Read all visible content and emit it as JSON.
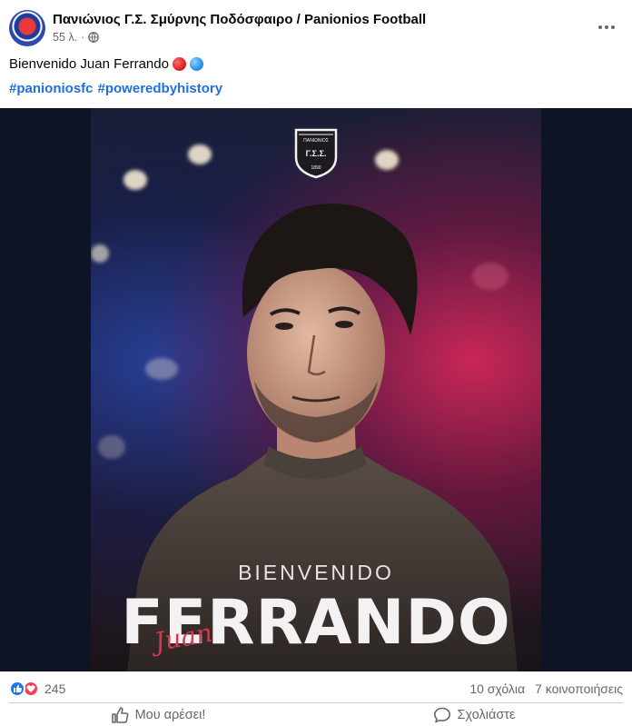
{
  "post": {
    "page_name": "Πανιώνιος Γ.Σ. Σμύρνης Ποδόσφαιρο / Panionios Football",
    "time": "55 λ.",
    "separator": "·",
    "caption": "Bienvenido Juan Ferrando",
    "hashtags": [
      "#panioniosfc",
      "#poweredbyhistory"
    ]
  },
  "poster": {
    "club_name": "ΠΑΝΙΩΝΙΟΣ",
    "club_initials": "Γ.Σ.Σ.",
    "club_year": "1890",
    "headline": "BIENVENIDO",
    "surname": "FERRANDO",
    "first_name_script": "Juan"
  },
  "engagement": {
    "reaction_count": "245",
    "comments": "10 σχόλια",
    "shares": "7 κοινοποιήσεις",
    "reactions": [
      "like-icon",
      "love-icon"
    ]
  },
  "actions": {
    "like_label": "Μου αρέσει!",
    "comment_label": "Σχολιάστε"
  },
  "colors": {
    "link": "#216fdb",
    "muted": "#65676b",
    "like_blue": "#1877f2",
    "love_red": "#f33e58"
  }
}
